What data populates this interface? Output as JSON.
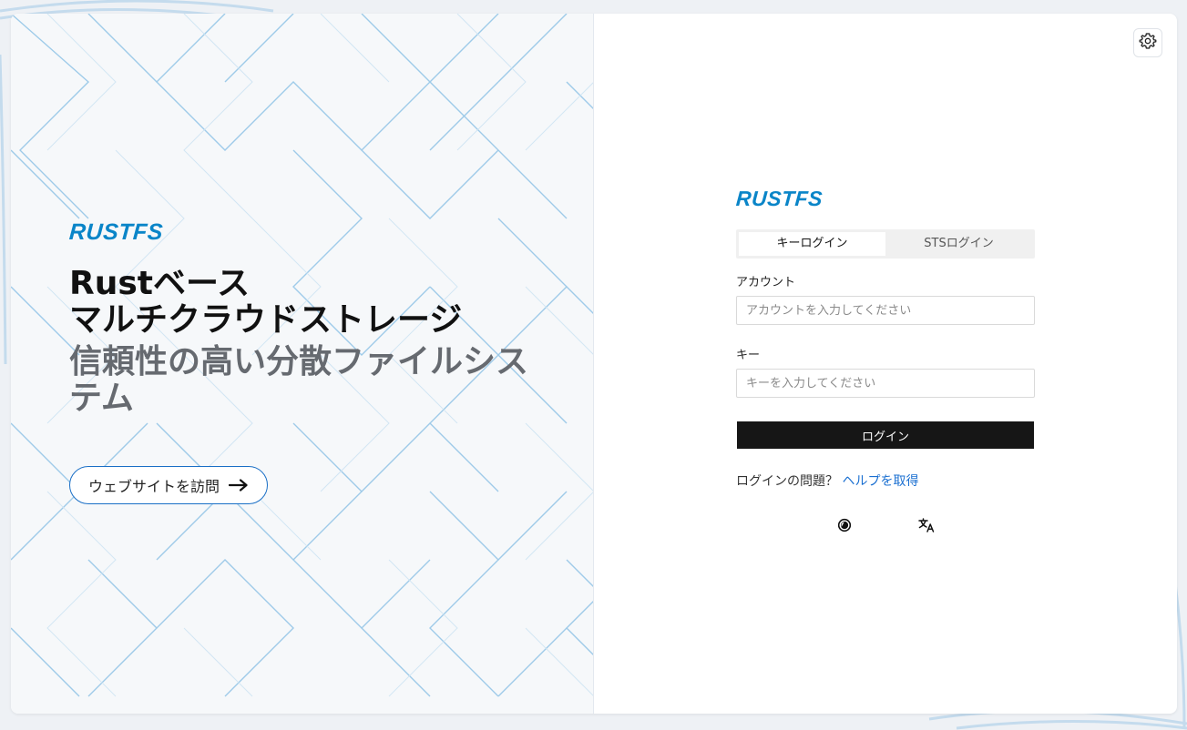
{
  "brand": {
    "name": "RUSTFS"
  },
  "hero": {
    "line1": "Rustベース",
    "line2": "マルチクラウドストレージ",
    "subtitle": "信頼性の高い分散ファイルシステム",
    "visit_label": "ウェブサイトを訪問"
  },
  "login": {
    "tabs": [
      "キーログイン",
      "STSログイン"
    ],
    "account_label": "アカウント",
    "account_placeholder": "アカウントを入力してください",
    "key_label": "キー",
    "key_placeholder": "キーを入力してください",
    "submit_label": "ログイン",
    "help_prefix": "ログインの問題？",
    "help_link": "ヘルプを取得"
  },
  "icons": {
    "settings": "gear-icon",
    "theme": "theme-toggle-icon",
    "language": "translate-icon",
    "visit_arrow": "arrow-right-icon"
  },
  "colors": {
    "brand": "#0a85c8",
    "link": "#1a6fd1",
    "button": "#161616",
    "visit_border": "#1a6fc6"
  }
}
